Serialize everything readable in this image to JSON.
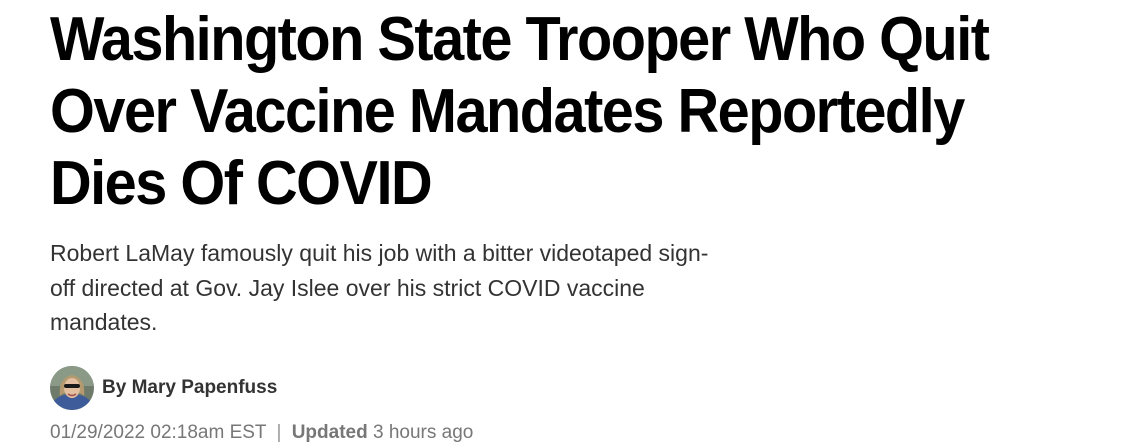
{
  "headline": {
    "lines": [
      "Washington State Trooper Who Quit",
      "Over Vaccine Mandates Reportedly",
      "Dies Of COVID"
    ]
  },
  "subhead": {
    "lines": [
      "Robert LaMay famously quit his job with a bitter videotaped sign-",
      "off directed at Gov. Jay Islee over his strict COVID vaccine",
      "mandates."
    ]
  },
  "byline": {
    "prefix": "By",
    "author": "Mary Papenfuss",
    "avatar_icon": "author-photo-icon"
  },
  "timestamps": {
    "published": "01/29/2022 02:18am EST",
    "separator": "|",
    "updated_label": "Updated",
    "updated_value": "3 hours ago"
  }
}
